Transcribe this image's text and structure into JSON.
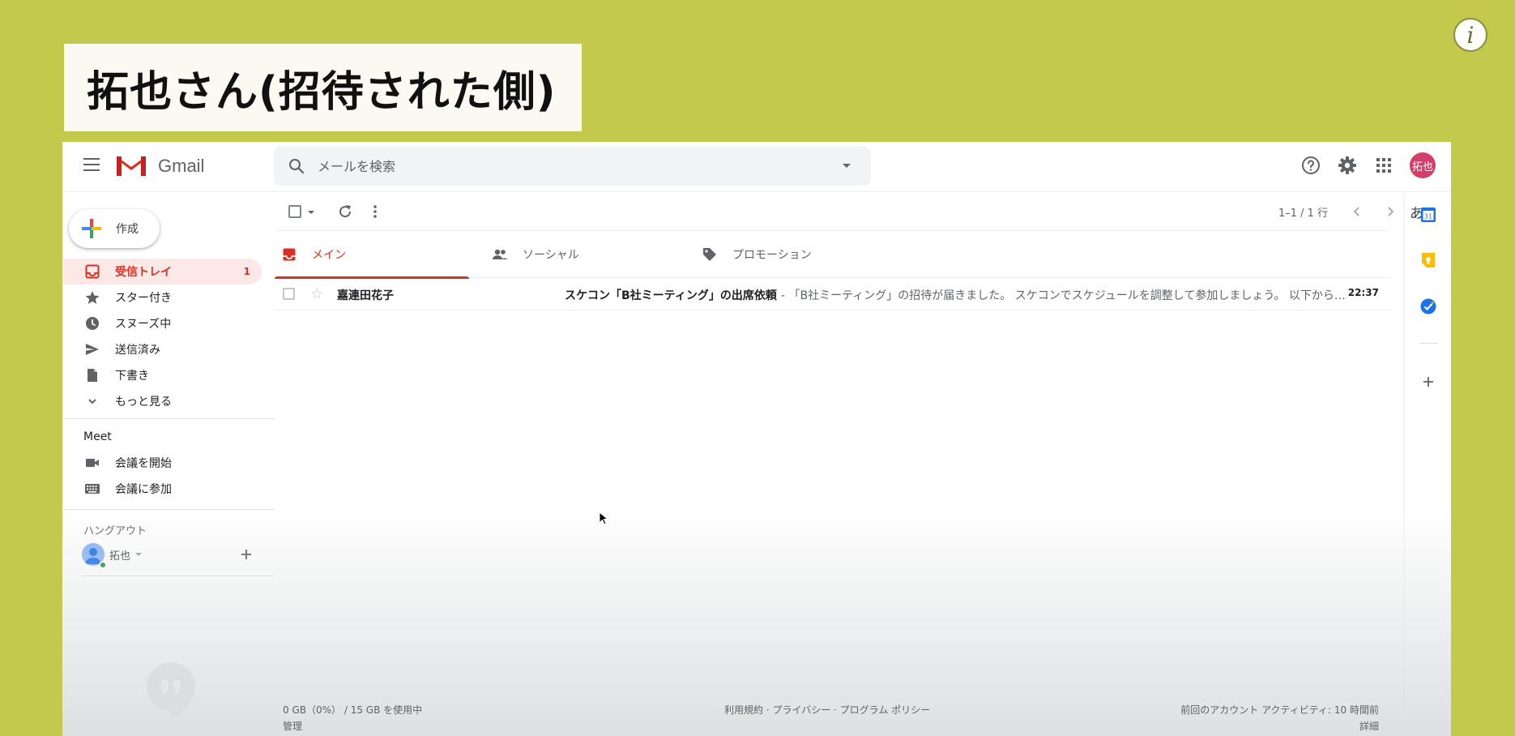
{
  "overlay": {
    "caption": "拓也さん(招待された側)",
    "info_glyph": "i"
  },
  "header": {
    "app_name": "Gmail",
    "search_placeholder": "メールを検索",
    "avatar_text": "拓也"
  },
  "compose": {
    "label": "作成"
  },
  "nav": [
    {
      "label": "受信トレイ",
      "count": "1",
      "icon": "inbox-icon",
      "active": true
    },
    {
      "label": "スター付き",
      "count": "",
      "icon": "star-icon"
    },
    {
      "label": "スヌーズ中",
      "count": "",
      "icon": "clock-icon"
    },
    {
      "label": "送信済み",
      "count": "",
      "icon": "send-icon"
    },
    {
      "label": "下書き",
      "count": "",
      "icon": "draft-icon"
    },
    {
      "label": "もっと見る",
      "count": "",
      "icon": "chevron-down-icon"
    }
  ],
  "meet": {
    "title": "Meet",
    "items": [
      {
        "label": "会議を開始",
        "icon": "video-camera-icon"
      },
      {
        "label": "会議に参加",
        "icon": "keyboard-icon"
      }
    ]
  },
  "hangouts": {
    "title": "ハングアウト",
    "user": "拓也"
  },
  "toolbar": {
    "pagination": "1–1 / 1 行",
    "input_tool": "あ"
  },
  "tabs": [
    {
      "label": "メイン",
      "icon": "inbox-icon",
      "active": true
    },
    {
      "label": "ソーシャル",
      "icon": "people-icon"
    },
    {
      "label": "プロモーション",
      "icon": "tag-icon"
    }
  ],
  "emails": [
    {
      "sender": "嘉連田花子",
      "subject": "スケコン「B社ミーティング」の出席依頼",
      "snippet": " - 「B社ミーティング」の招待が届きました。 スケコンでスケジュールを調整して参加しましょう。 以下から…",
      "time": "22:37"
    }
  ],
  "footer": {
    "storage": "0 GB（0%） / 15 GB を使用中",
    "manage": "管理",
    "links": "利用規約 · プライバシー · プログラム ポリシー",
    "activity": "前回のアカウント アクティビティ: 10 時間前",
    "details": "詳細"
  },
  "side_panel": {
    "calendar_day": "31"
  },
  "colors": {
    "background": "#c3c94d",
    "accent_red": "#d93025",
    "active_nav_bg": "#fce8e6",
    "avatar": "#d23f6b"
  }
}
